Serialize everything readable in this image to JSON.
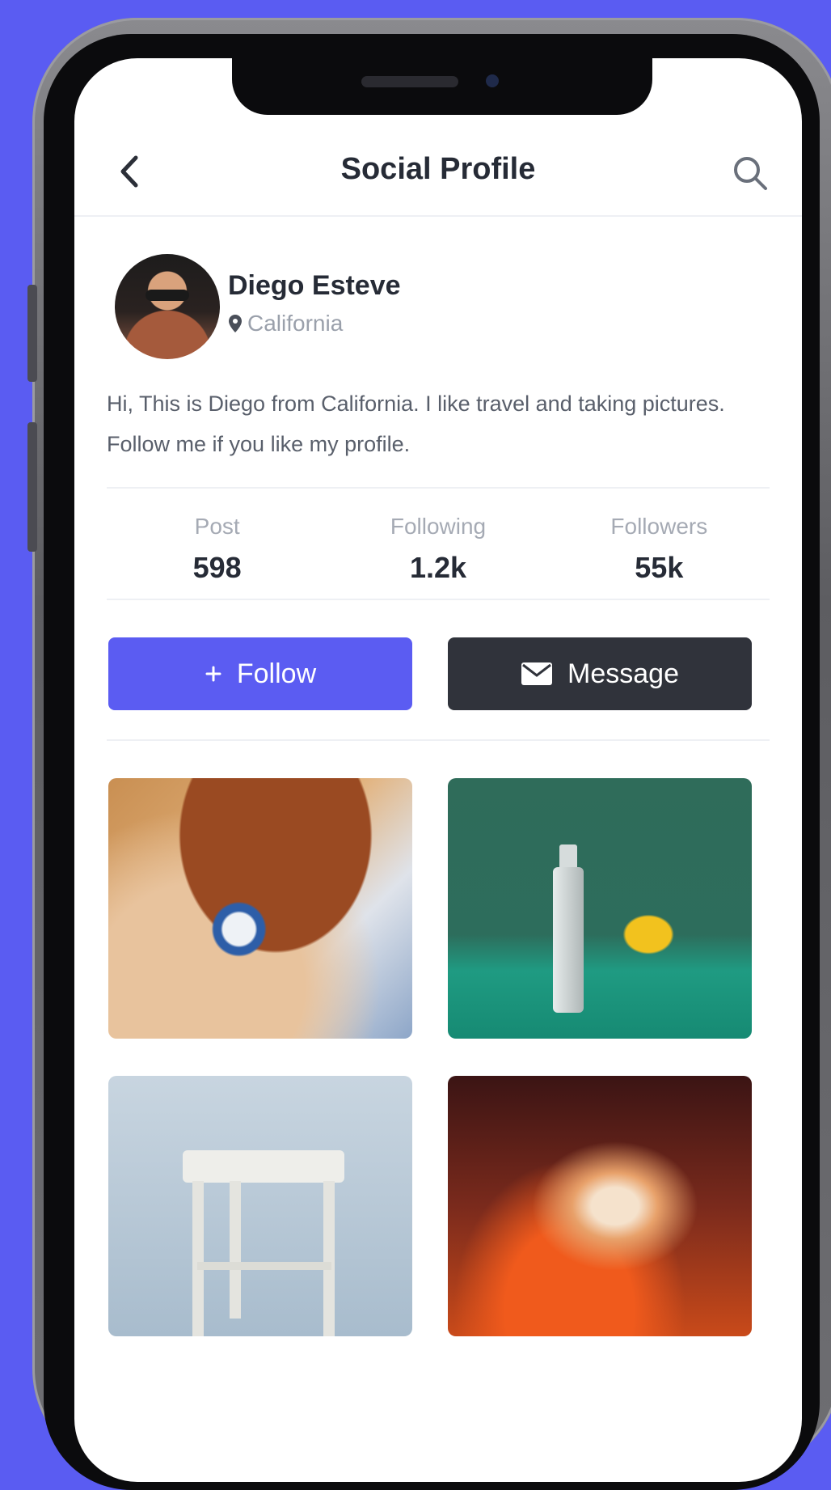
{
  "header": {
    "title": "Social Profile"
  },
  "profile": {
    "name": "Diego Esteve",
    "location": "California",
    "bio": "Hi, This is Diego from California. I like travel and taking pictures. Follow me if you like my profile."
  },
  "stats": [
    {
      "label": "Post",
      "value": "598"
    },
    {
      "label": "Following",
      "value": "1.2k"
    },
    {
      "label": "Followers",
      "value": "55k"
    }
  ],
  "actions": {
    "follow_label": "Follow",
    "message_label": "Message"
  },
  "colors": {
    "background": "#5a5cf2",
    "accent": "#5b5cf2",
    "dark_button": "#30333b",
    "text": "#262b36"
  },
  "icons": {
    "back": "chevron-left-icon",
    "search": "search-icon",
    "location": "location-pin-icon",
    "follow": "plus-icon",
    "message": "envelope-icon"
  }
}
